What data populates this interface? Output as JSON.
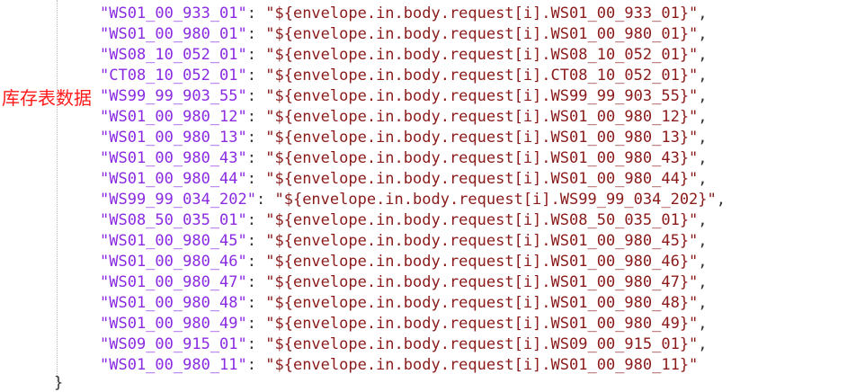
{
  "annotation": "库存表数据",
  "lines": [
    {
      "key": "\"WS01_00_933_01\"",
      "value": "\"${envelope.in.body.request[i].WS01_00_933_01}\"",
      "trail": ","
    },
    {
      "key": "\"WS01_00_980_01\"",
      "value": "\"${envelope.in.body.request[i].WS01_00_980_01}\"",
      "trail": ","
    },
    {
      "key": "\"WS08_10_052_01\"",
      "value": "\"${envelope.in.body.request[i].WS08_10_052_01}\"",
      "trail": ","
    },
    {
      "key": "\"CT08_10_052_01\"",
      "value": "\"${envelope.in.body.request[i].CT08_10_052_01}\"",
      "trail": ","
    },
    {
      "key": "\"WS99_99_903_55\"",
      "value": "\"${envelope.in.body.request[i].WS99_99_903_55}\"",
      "trail": ","
    },
    {
      "key": "\"WS01_00_980_12\"",
      "value": "\"${envelope.in.body.request[i].WS01_00_980_12}\"",
      "trail": ","
    },
    {
      "key": "\"WS01_00_980_13\"",
      "value": "\"${envelope.in.body.request[i].WS01_00_980_13}\"",
      "trail": ","
    },
    {
      "key": "\"WS01_00_980_43\"",
      "value": "\"${envelope.in.body.request[i].WS01_00_980_43}\"",
      "trail": ","
    },
    {
      "key": "\"WS01_00_980_44\"",
      "value": "\"${envelope.in.body.request[i].WS01_00_980_44}\"",
      "trail": ","
    },
    {
      "key": "\"WS99_99_034_202\"",
      "value": "\"${envelope.in.body.request[i].WS99_99_034_202}\"",
      "trail": ","
    },
    {
      "key": "\"WS08_50_035_01\"",
      "value": "\"${envelope.in.body.request[i].WS08_50_035_01}\"",
      "trail": ","
    },
    {
      "key": "\"WS01_00_980_45\"",
      "value": "\"${envelope.in.body.request[i].WS01_00_980_45}\"",
      "trail": ","
    },
    {
      "key": "\"WS01_00_980_46\"",
      "value": "\"${envelope.in.body.request[i].WS01_00_980_46}\"",
      "trail": ","
    },
    {
      "key": "\"WS01_00_980_47\"",
      "value": "\"${envelope.in.body.request[i].WS01_00_980_47}\"",
      "trail": ","
    },
    {
      "key": "\"WS01_00_980_48\"",
      "value": "\"${envelope.in.body.request[i].WS01_00_980_48}\"",
      "trail": ","
    },
    {
      "key": "\"WS01_00_980_49\"",
      "value": "\"${envelope.in.body.request[i].WS01_00_980_49}\"",
      "trail": ","
    },
    {
      "key": "\"WS09_00_915_01\"",
      "value": "\"${envelope.in.body.request[i].WS09_00_915_01}\"",
      "trail": ","
    },
    {
      "key": "\"WS01_00_980_11\"",
      "value": "\"${envelope.in.body.request[i].WS01_00_980_11}\"",
      "trail": ""
    }
  ],
  "closing_brace": "}",
  "colors": {
    "key": "#8a2be2",
    "value": "#8b1a1a",
    "punctuation": "#333333",
    "annotation": "#ff1a1a"
  }
}
